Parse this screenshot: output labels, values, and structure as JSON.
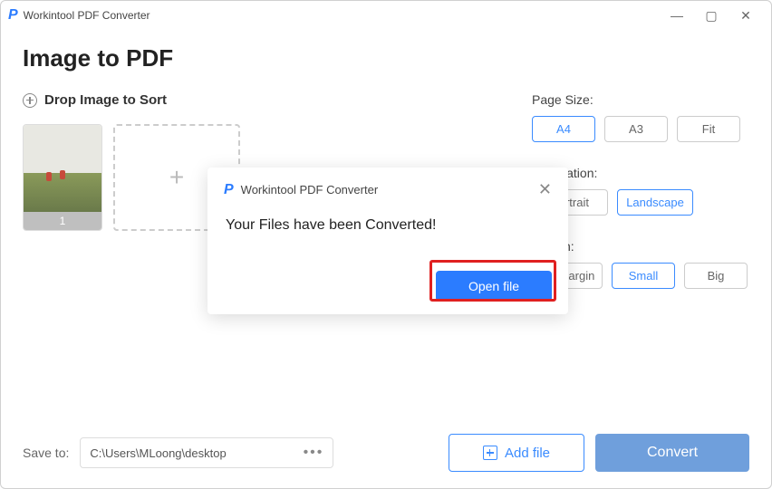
{
  "app": {
    "title": "Workintool PDF Converter"
  },
  "page": {
    "heading": "Image to PDF"
  },
  "drop": {
    "label": "Drop Image to Sort",
    "thumb_number": "1"
  },
  "options": {
    "page_size": {
      "label": "Page Size:",
      "a4": "A4",
      "a3": "A3",
      "fit": "Fit"
    },
    "orientation": {
      "label": "Orientation:",
      "portrait": "Portrait",
      "landscape": "Landscape"
    },
    "margin": {
      "label": "Margin:",
      "no": "No-margin",
      "small": "Small",
      "big": "Big"
    }
  },
  "footer": {
    "save_label": "Save to:",
    "save_path": "C:\\Users\\MLoong\\desktop",
    "add_file": "Add file",
    "convert": "Convert"
  },
  "modal": {
    "title": "Workintool PDF Converter",
    "message": "Your Files have been Converted!",
    "open_file": "Open file"
  }
}
